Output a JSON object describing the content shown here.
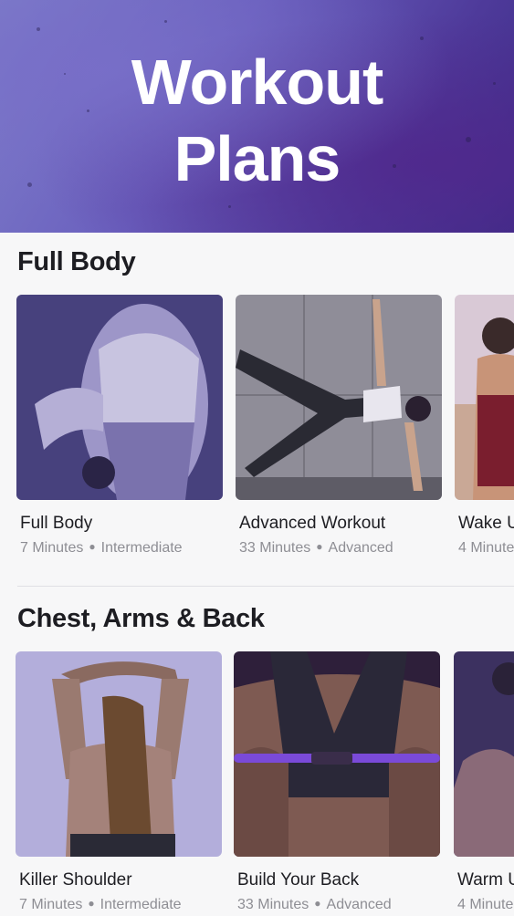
{
  "header": {
    "title_line1": "Workout",
    "title_line2": "Plans"
  },
  "sections": [
    {
      "title": "Full Body",
      "cards": [
        {
          "title": "Full Body",
          "duration": "7 Minutes",
          "level": "Intermediate"
        },
        {
          "title": "Advanced Workout",
          "duration": "33 Minutes",
          "level": "Advanced"
        },
        {
          "title": "Wake U",
          "duration": "4 Minute",
          "level": ""
        }
      ]
    },
    {
      "title": "Chest, Arms & Back",
      "cards": [
        {
          "title": "Killer Shoulder",
          "duration": "7 Minutes",
          "level": "Intermediate"
        },
        {
          "title": "Build Your Back",
          "duration": "33 Minutes",
          "level": "Advanced"
        },
        {
          "title": "Warm U",
          "duration": "4 Minute",
          "level": ""
        }
      ]
    }
  ],
  "colors": {
    "hero_tint": "#5a4fb0",
    "card_tint": "#4d4490",
    "text_primary": "#1d1d22",
    "text_secondary": "#8e8e94"
  }
}
